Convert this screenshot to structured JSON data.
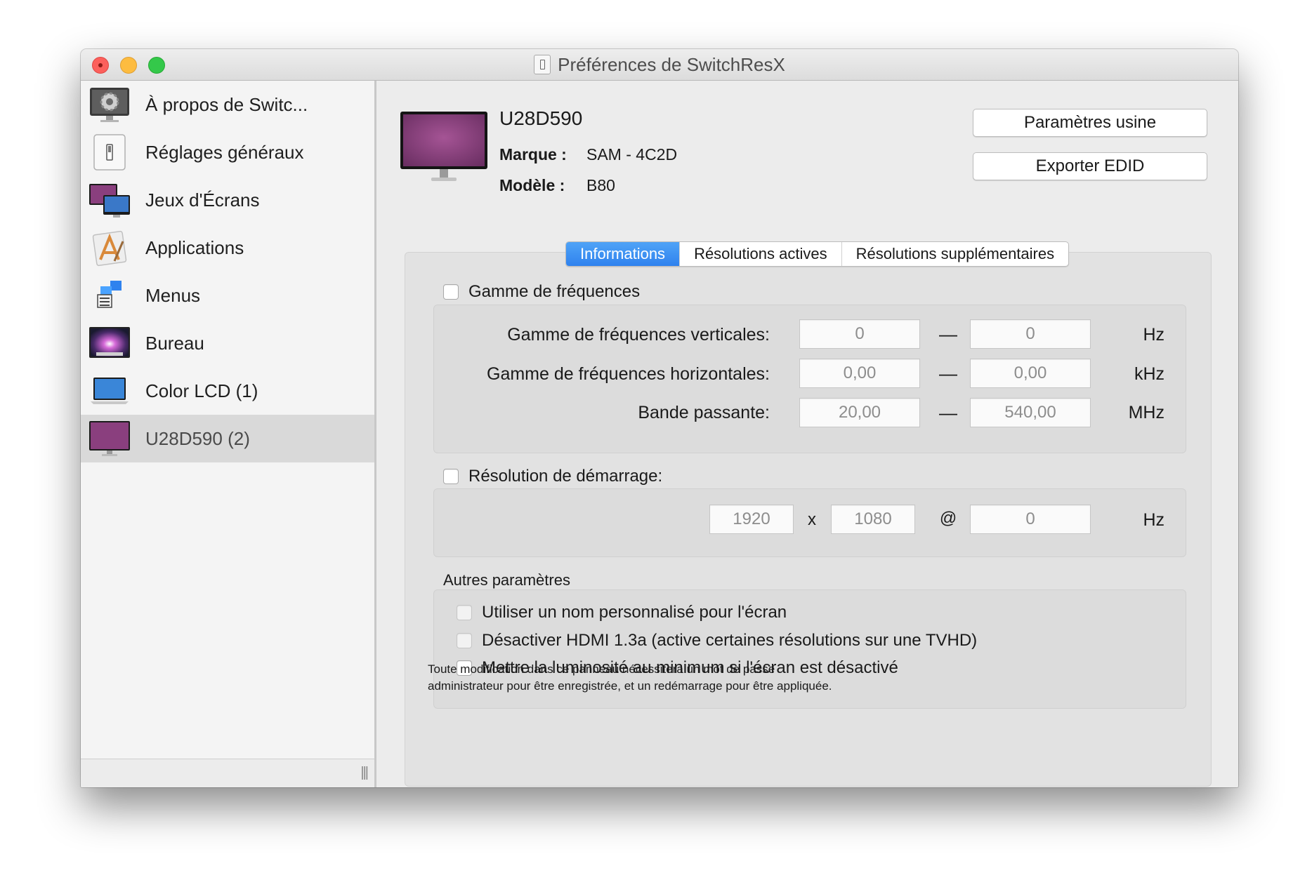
{
  "window": {
    "title": "Préférences de SwitchResX"
  },
  "sidebar": {
    "items": [
      {
        "label": "À propos de Switc...",
        "icon": "gear-icon"
      },
      {
        "label": "Réglages généraux",
        "icon": "switch-icon"
      },
      {
        "label": "Jeux d'Écrans",
        "icon": "display-set-icon"
      },
      {
        "label": "Applications",
        "icon": "applications-icon"
      },
      {
        "label": "Menus",
        "icon": "menus-icon"
      },
      {
        "label": "Bureau",
        "icon": "desktop-icon"
      },
      {
        "label": "Color LCD (1)",
        "icon": "laptop-display-icon"
      },
      {
        "label": "U28D590 (2)",
        "icon": "monitor-icon",
        "selected": true
      }
    ]
  },
  "device": {
    "name": "U28D590",
    "brand_label": "Marque :",
    "brand_value": "SAM - 4C2D",
    "model_label": "Modèle :",
    "model_value": "B80"
  },
  "buttons": {
    "factory": "Paramètres usine",
    "export_edid": "Exporter EDID"
  },
  "tabs": [
    {
      "label": "Informations",
      "active": true
    },
    {
      "label": "Résolutions actives"
    },
    {
      "label": "Résolutions supplémentaires"
    }
  ],
  "frequency": {
    "checkbox_label": "Gamme de fréquences",
    "rows": [
      {
        "label": "Gamme de fréquences verticales:",
        "min": "0",
        "max": "0",
        "unit": "Hz"
      },
      {
        "label": "Gamme de fréquences horizontales:",
        "min": "0,00",
        "max": "0,00",
        "unit": "kHz"
      },
      {
        "label": "Bande passante:",
        "min": "20,00",
        "max": "540,00",
        "unit": "MHz"
      }
    ],
    "separator": "—"
  },
  "startup": {
    "checkbox_label": "Résolution de démarrage:",
    "width": "1920",
    "x_sep": "x",
    "height": "1080",
    "at_sep": "@",
    "rate": "0",
    "unit": "Hz"
  },
  "other": {
    "title": "Autres paramètres",
    "options": [
      "Utiliser un nom personnalisé pour l'écran",
      "Désactiver HDMI 1.3a (active certaines résolutions sur une TVHD)",
      "Mettre la luminosité au minimum si l'écran est désactivé"
    ]
  },
  "note": {
    "line1": "Toute modification dans ce panneau nécessitera un mot de passe",
    "line2": "administrateur pour être enregistrée, et un redémarrage pour être appliquée."
  },
  "colors": {
    "accent": "#2f82ee",
    "close": "#fc605c",
    "minimize": "#fdbc40",
    "zoom": "#34c84a",
    "screen_purple": "#8a3f7e"
  }
}
